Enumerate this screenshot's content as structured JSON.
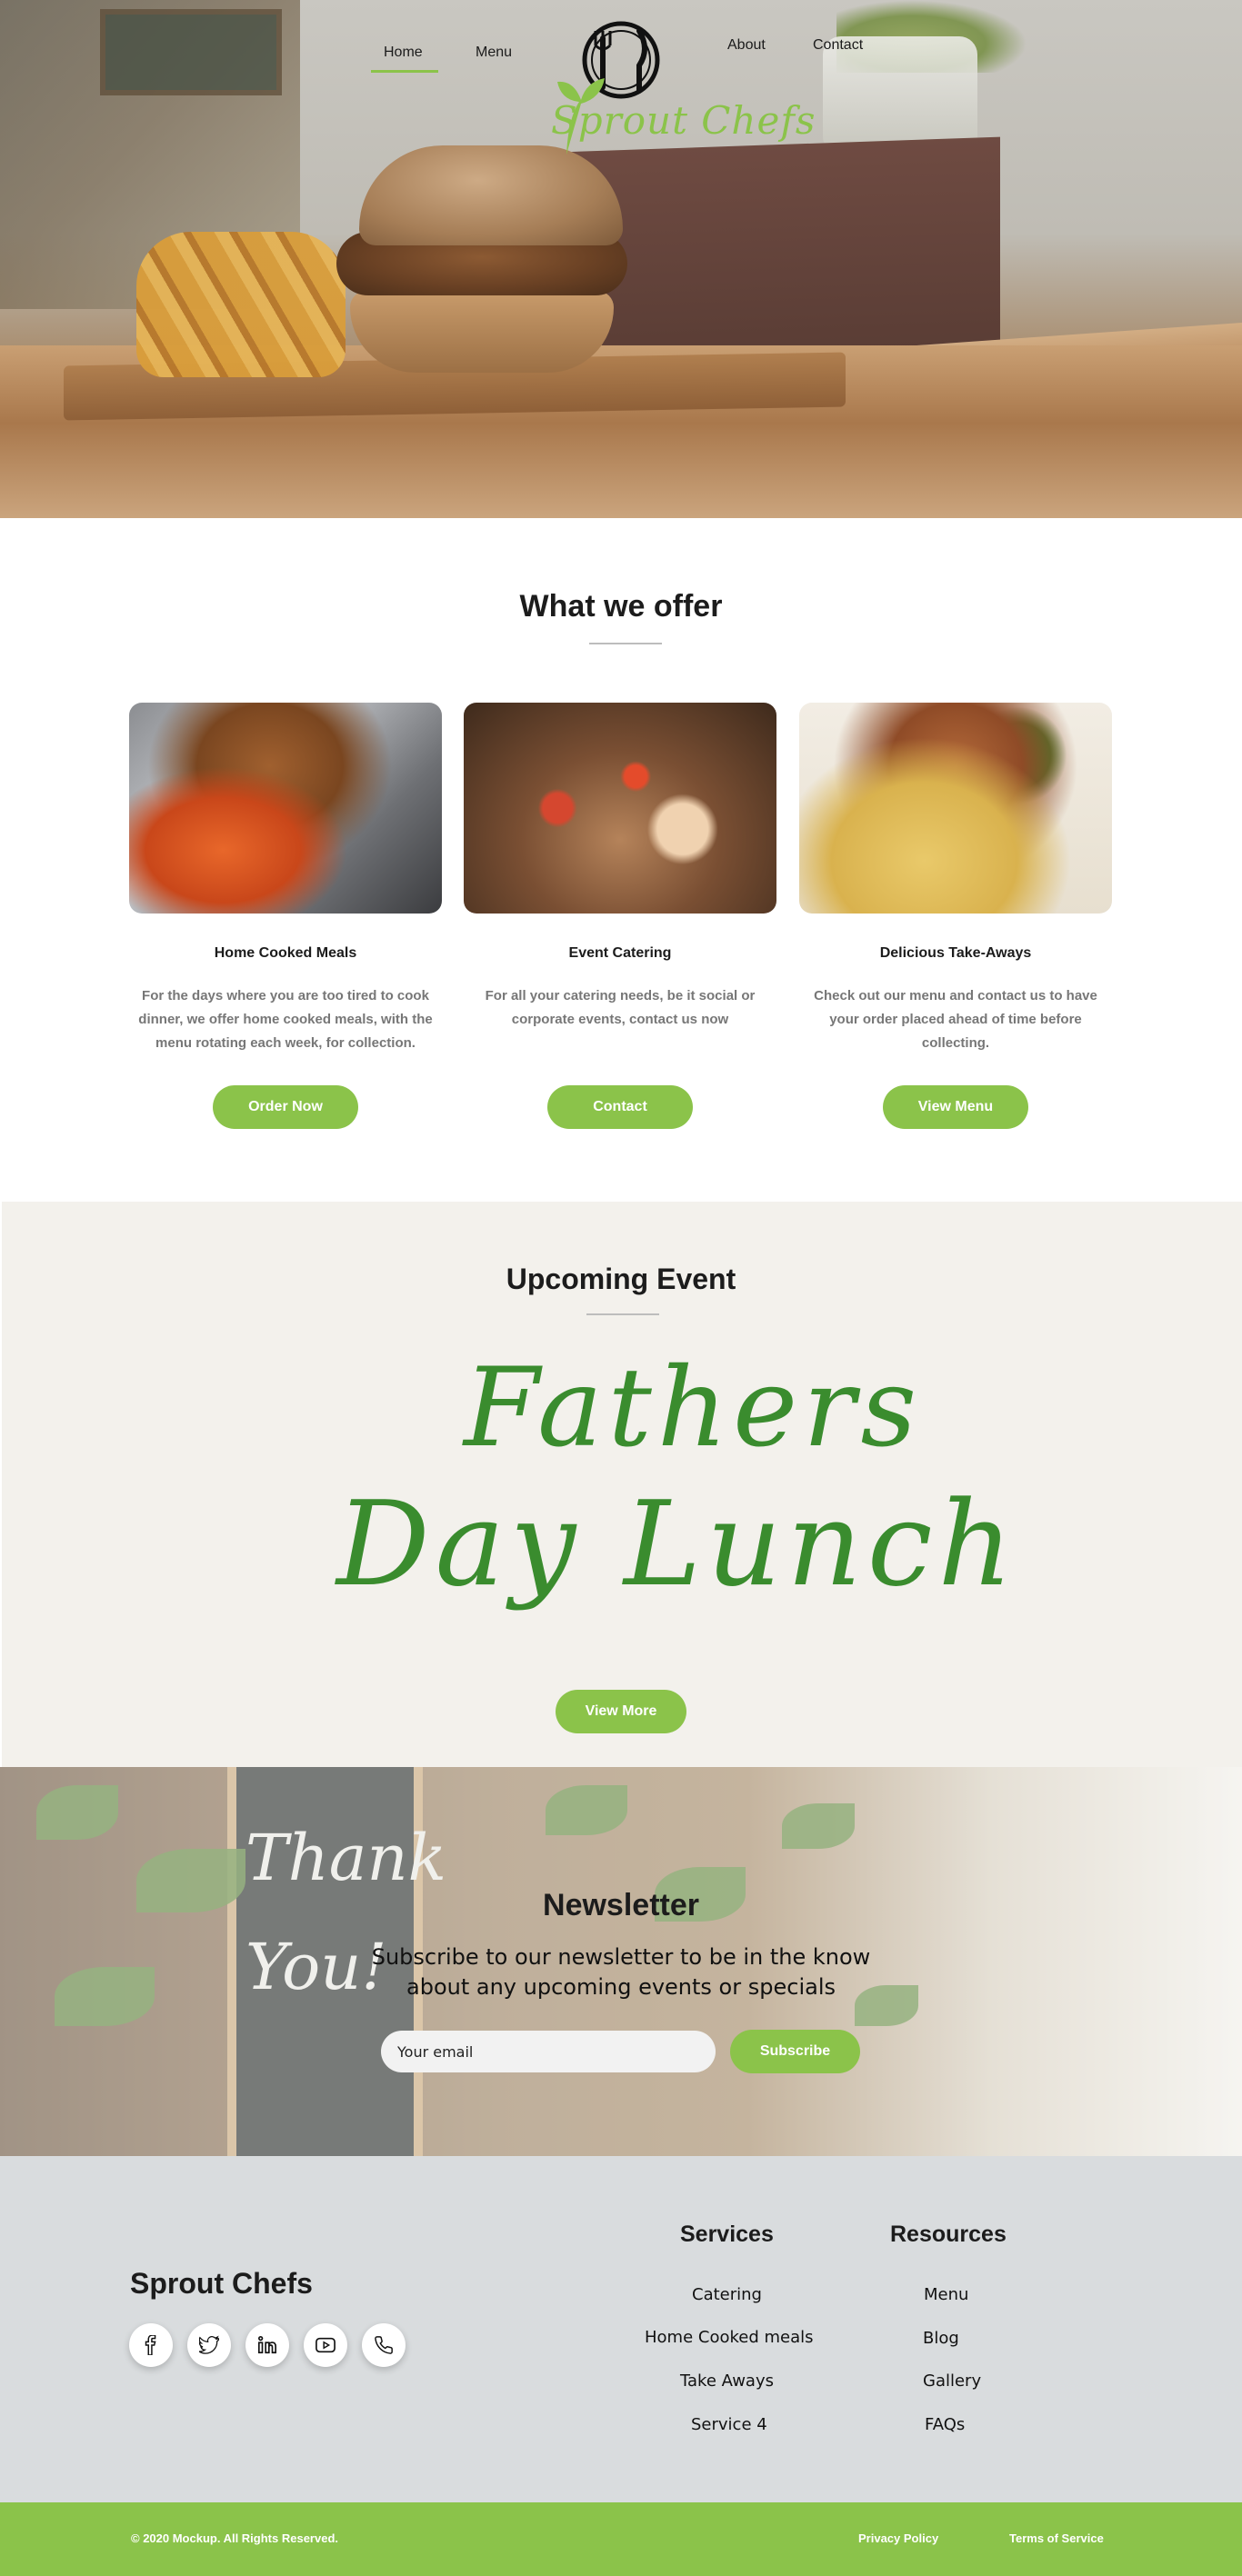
{
  "nav": {
    "home": "Home",
    "menu": "Menu",
    "about": "About",
    "contact": "Contact"
  },
  "logo": {
    "text": "Sprout Chefs"
  },
  "offer": {
    "title": "What we offer",
    "cards": [
      {
        "heading": "Home Cooked Meals",
        "text": "For the days where you are too tired to cook dinner, we offer home cooked meals, with the menu rotating each week, for collection.",
        "button": "Order Now"
      },
      {
        "heading": "Event Catering",
        "text": "For all your catering needs, be it social or corporate events, contact us now",
        "button": "Contact"
      },
      {
        "heading": "Delicious Take-Aways",
        "text": "Check out our menu and contact us to have your order placed ahead of time before collecting.",
        "button": "View Menu"
      }
    ]
  },
  "event": {
    "title": "Upcoming Event",
    "script_line1": "Fathers",
    "script_line2": "Day Lunch",
    "button": "View More"
  },
  "newsletter": {
    "board_line1": "Thank",
    "board_line2": "You!",
    "title": "Newsletter",
    "subtitle": "Subscribe to our newsletter to be in the know about any upcoming events or specials",
    "email_placeholder": "Your email",
    "button": "Subscribe"
  },
  "footer": {
    "brand": "Sprout Chefs",
    "social_icons": [
      "facebook-icon",
      "twitter-icon",
      "linkedin-icon",
      "youtube-icon",
      "phone-icon"
    ],
    "services": {
      "title": "Services",
      "links": [
        "Catering",
        "Home Cooked meals",
        "Take Aways",
        "Service 4"
      ]
    },
    "resources": {
      "title": "Resources",
      "links": [
        "Menu",
        "Blog",
        "Gallery",
        "FAQs"
      ]
    },
    "copyright": "© 2020 Mockup.  All Rights Reserved.",
    "privacy": "Privacy Policy",
    "terms": "Terms of Service"
  },
  "colors": {
    "accent": "#8bc34a",
    "script_green": "#3a8c2e",
    "event_bg": "#f3f1ec",
    "footer_bg": "#d9dcde"
  }
}
